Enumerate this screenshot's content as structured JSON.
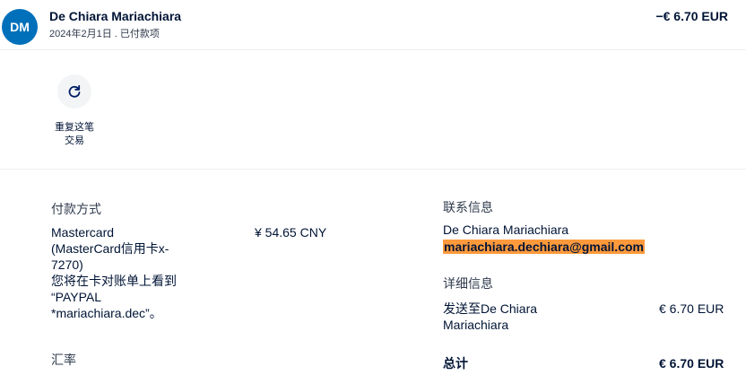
{
  "header": {
    "avatar_initials": "DM",
    "name": "De Chiara Mariachiara",
    "subline": "2024年2月1日 . 已付款项",
    "amount": "−€ 6.70 EUR"
  },
  "actions": {
    "repeat_label_line1": "重复这笔",
    "repeat_label_line2": "交易",
    "repeat_icon": "refresh-icon"
  },
  "payment": {
    "title": "付款方式",
    "method_lines": [
      "Mastercard",
      "(MasterCard信用卡x-",
      "7270)",
      "您将在卡对账单上看到",
      "“PAYPAL",
      "*mariachiara.dec”。"
    ],
    "amount": "¥ 54.65 CNY",
    "exchange_title": "汇率"
  },
  "contact": {
    "title": "联系信息",
    "name": "De Chiara Mariachiara",
    "email": "mariachiara.dechiara@gmail.com"
  },
  "detail": {
    "title": "详细信息",
    "sent_to_line1": "发送至De Chiara",
    "sent_to_line2": "Mariachiara",
    "sent_amount": "€ 6.70 EUR",
    "total_label": "总计",
    "total_amount": "€ 6.70 EUR"
  },
  "colors": {
    "avatar_bg": "#0070ba",
    "email_highlight": "#ff9a3c"
  }
}
